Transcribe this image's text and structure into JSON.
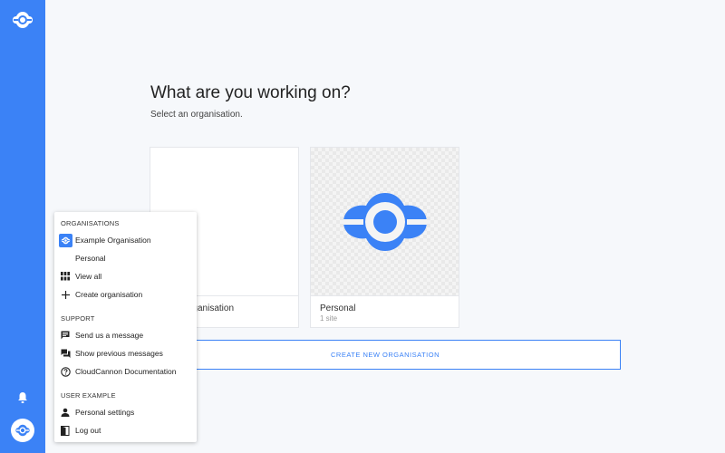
{
  "page": {
    "title": "What are you working on?",
    "subtitle": "Select an organisation."
  },
  "cards": [
    {
      "name": "Example Organisation",
      "visible_name": "rganisation",
      "meta": ""
    },
    {
      "name": "Personal",
      "meta": "1 site"
    }
  ],
  "create_button": {
    "label": "CREATE NEW ORGANISATION"
  },
  "menu": {
    "organisations_heading": "ORGANISATIONS",
    "organisation_items": [
      {
        "label": "Example Organisation",
        "icon": "cloudcannon-logo-icon"
      },
      {
        "label": "Personal",
        "icon": ""
      },
      {
        "label": "View all",
        "icon": "grid-icon"
      },
      {
        "label": "Create organisation",
        "icon": "plus-icon"
      }
    ],
    "support_heading": "SUPPORT",
    "support_items": [
      {
        "label": "Send us a message",
        "icon": "message-icon"
      },
      {
        "label": "Show previous messages",
        "icon": "forum-icon"
      },
      {
        "label": "CloudCannon Documentation",
        "icon": "help-icon"
      }
    ],
    "user_heading": "USER EXAMPLE",
    "user_items": [
      {
        "label": "Personal settings",
        "icon": "person-icon"
      },
      {
        "label": "Log out",
        "icon": "logout-icon"
      }
    ]
  },
  "colors": {
    "accent": "#3b82f6",
    "background": "#f6f8fb"
  }
}
